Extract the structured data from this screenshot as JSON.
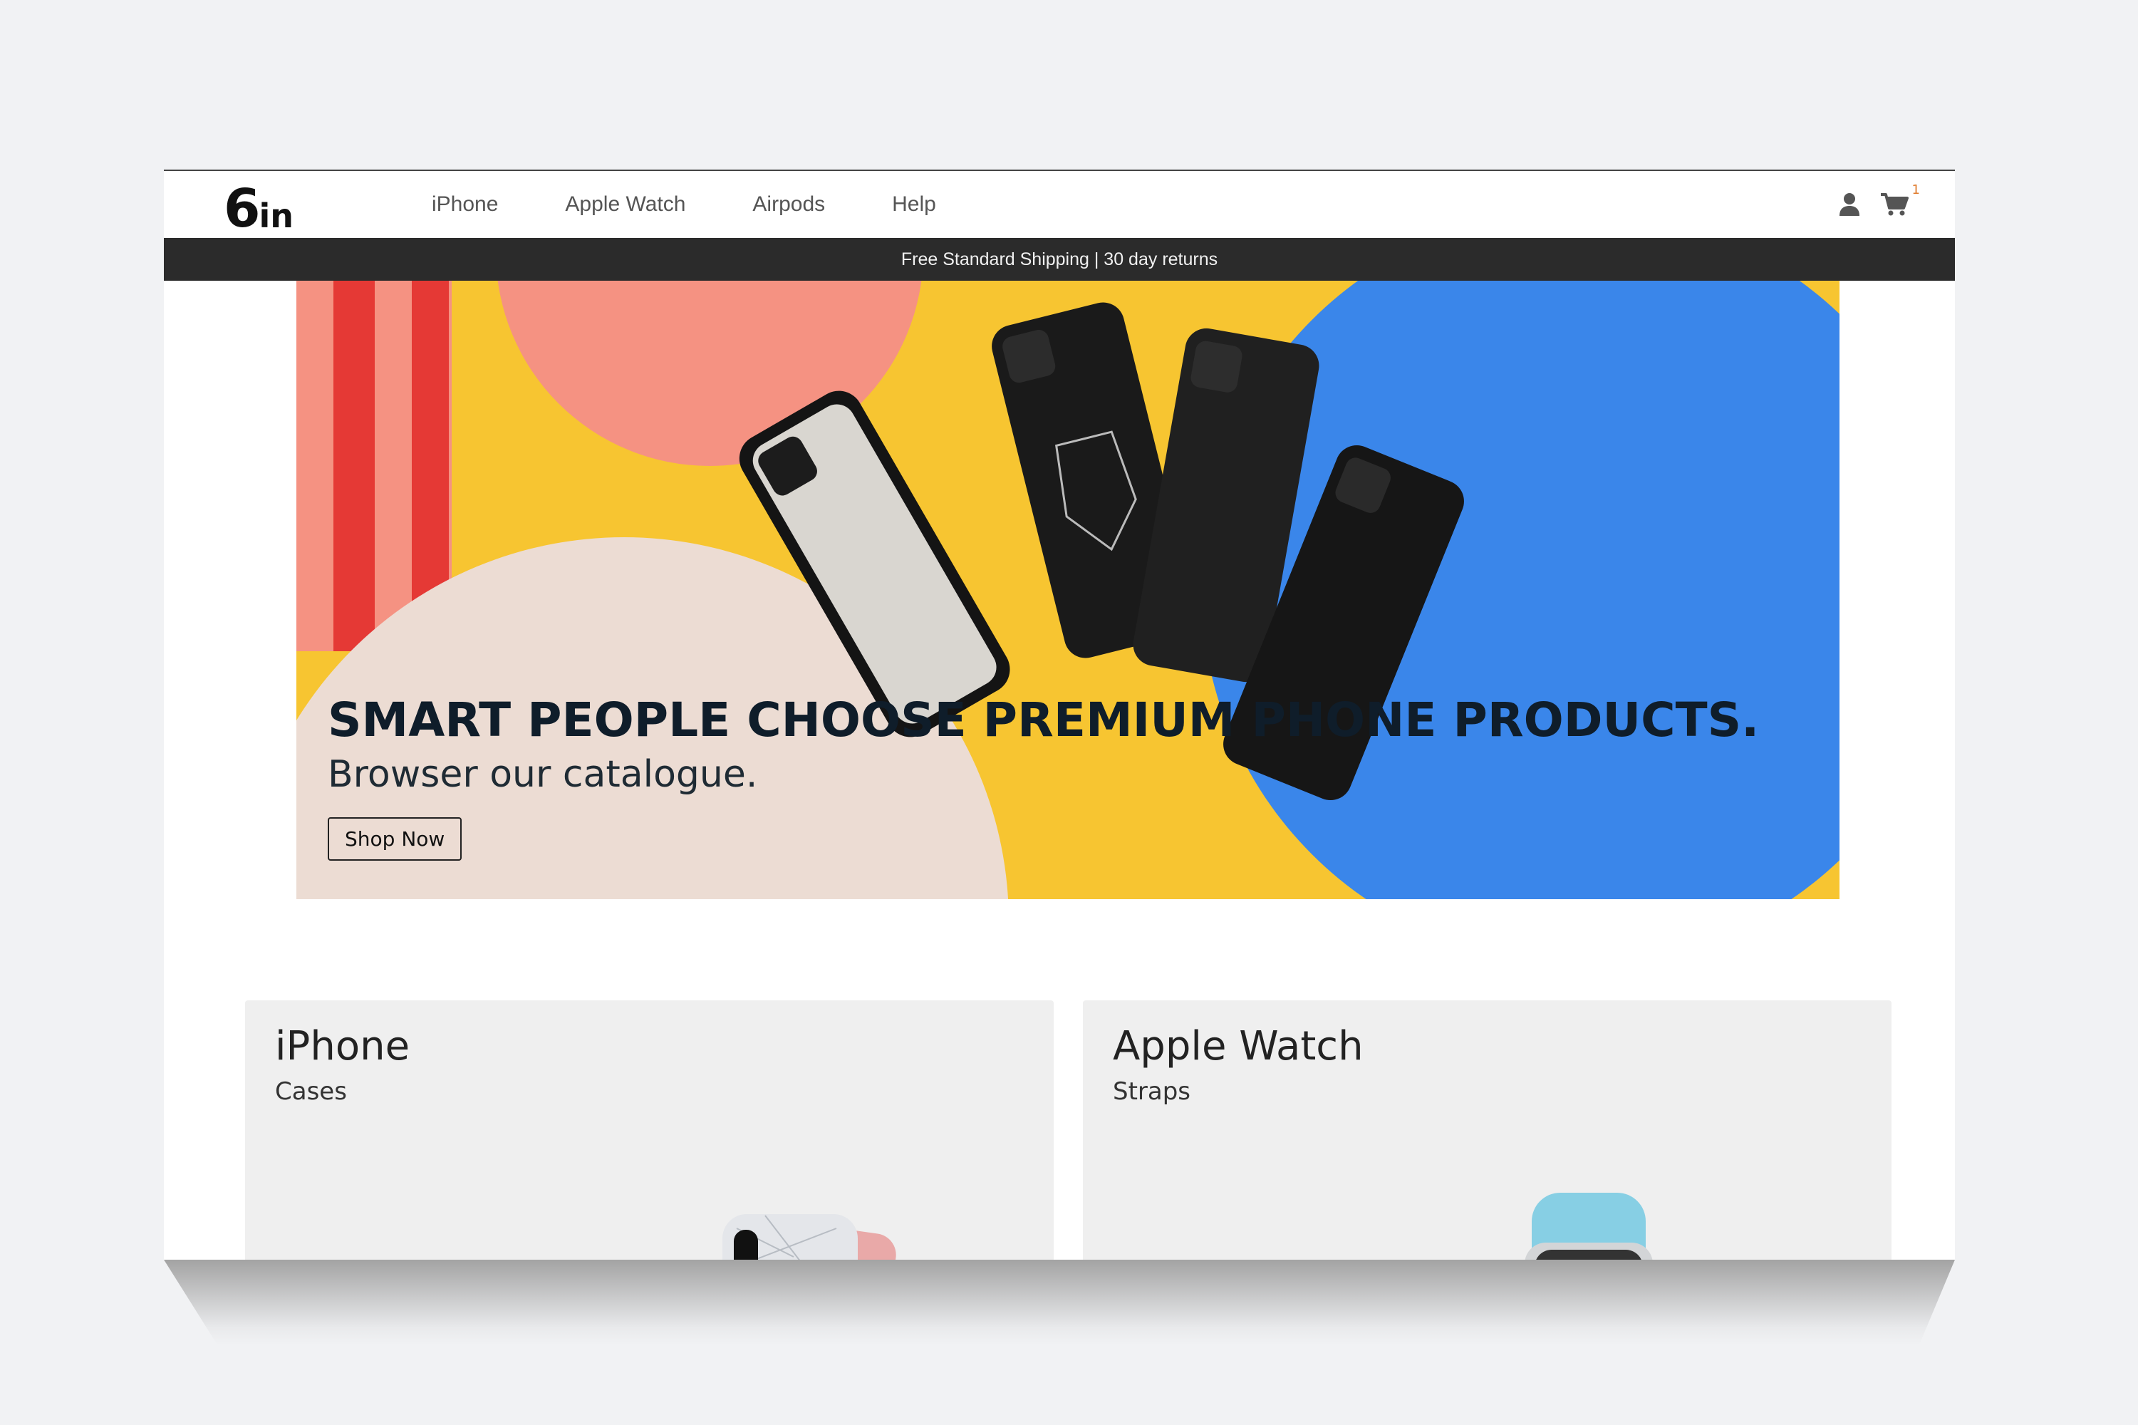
{
  "brand": {
    "logo_main": "6",
    "logo_suffix": "in"
  },
  "nav": {
    "links": [
      {
        "label": "iPhone"
      },
      {
        "label": "Apple Watch"
      },
      {
        "label": "Airpods"
      },
      {
        "label": "Help"
      }
    ],
    "icons": {
      "account": "user-icon",
      "cart": "cart-icon"
    },
    "cart_count": "1"
  },
  "promo": {
    "text": "Free Standard Shipping | 30 day returns"
  },
  "hero": {
    "headline": "SMART PEOPLE CHOOSE PREMIUM PHONE PRODUCTS.",
    "subheadline": "Browser our catalogue.",
    "cta_label": "Shop Now"
  },
  "categories": [
    {
      "title": "iPhone",
      "subtitle": "Cases"
    },
    {
      "title": "Apple Watch",
      "subtitle": "Straps"
    }
  ],
  "colors": {
    "hero_yellow": "#f7c531",
    "hero_blue": "#3a86ea",
    "hero_coral": "#f59282",
    "hero_red": "#e53935",
    "hero_cream": "#ecdcd3",
    "promo_bar": "#2b2b2b",
    "cart_badge": "#e07a2a"
  }
}
